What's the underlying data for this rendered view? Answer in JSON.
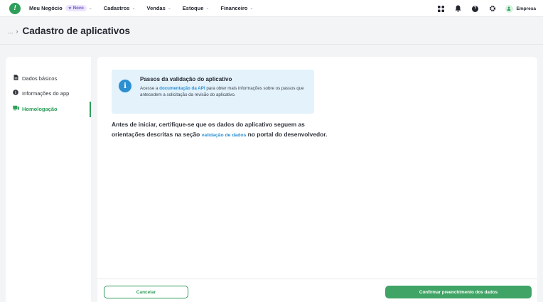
{
  "colors": {
    "brand": "#2e9e5a",
    "info_background": "#e3f2fb",
    "info_icon": "#2b8fd1",
    "link": "#2b8fd1"
  },
  "topbar": {
    "logo_icon": "exclamation-logo-icon",
    "nav": [
      {
        "label": "Meu Negócio",
        "badge": "Novo"
      },
      {
        "label": "Cadastros"
      },
      {
        "label": "Vendas"
      },
      {
        "label": "Estoque"
      },
      {
        "label": "Financeiro"
      }
    ],
    "icons": [
      "apps-grid-icon",
      "bell-icon",
      "help-icon",
      "gear-icon"
    ],
    "user": {
      "name": "Empresa",
      "avatar_icon": "user-icon"
    }
  },
  "header": {
    "breadcrumb_ellipsis": "...",
    "breadcrumb_separator": "›",
    "title": "Cadastro de aplicativos"
  },
  "sidebar": {
    "items": [
      {
        "label": "Dados básicos",
        "icon": "document-icon",
        "active": false
      },
      {
        "label": "Informações do app",
        "icon": "info-icon",
        "active": false
      },
      {
        "label": "Homologação",
        "icon": "device-icon",
        "active": true
      }
    ]
  },
  "main": {
    "info": {
      "title": "Passos da validação do aplicativo",
      "text_before": "Acesse a ",
      "link": "documentação da API",
      "text_after": " para obter mais informações sobre os passos que antecedem a solicitação da revisão do aplicativo."
    },
    "intro": {
      "text_before": "Antes de iniciar, certifique-se que os dados do aplicativo seguem as orientações descritas na seção ",
      "link": "validação de dados",
      "text_after": " no portal do desenvolvedor."
    }
  },
  "footer": {
    "cancel_label": "Cancelar",
    "confirm_label": "Confirmar preenchimento dos dados"
  }
}
